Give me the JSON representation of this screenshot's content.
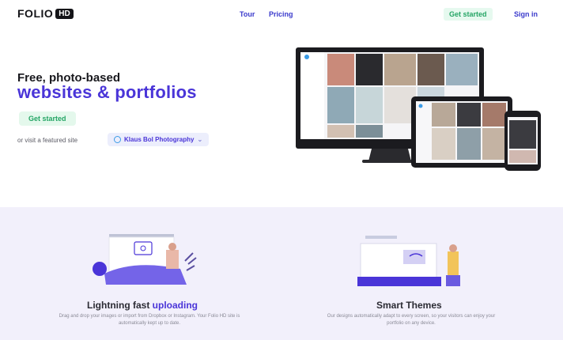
{
  "brand": {
    "logo_text": "FOLIO",
    "logo_badge": "HD"
  },
  "nav": {
    "tour": "Tour",
    "pricing": "Pricing",
    "get_started": "Get started",
    "sign_in": "Sign in"
  },
  "hero": {
    "line1": "Free, photo-based",
    "line2": "websites & portfolios",
    "cta": "Get started",
    "visit_text": "or visit a featured site",
    "featured_site": "Klaus Bol Photography",
    "featured_chevron": "⌄"
  },
  "features": [
    {
      "title_plain": "Lightning fast ",
      "title_highlight": "uploading",
      "desc": "Drag and drop your images or import from Dropbox or Instagram. Your Folio HD site is automatically kept up to date."
    },
    {
      "title_plain": "Smart Themes",
      "title_highlight": "",
      "desc": "Our designs automatically adapt to every screen, so your visitors can enjoy your portfolio on any device."
    }
  ],
  "colors": {
    "accent": "#4a35d8",
    "green": "#25a565",
    "lavender": "#f2f0fb"
  }
}
